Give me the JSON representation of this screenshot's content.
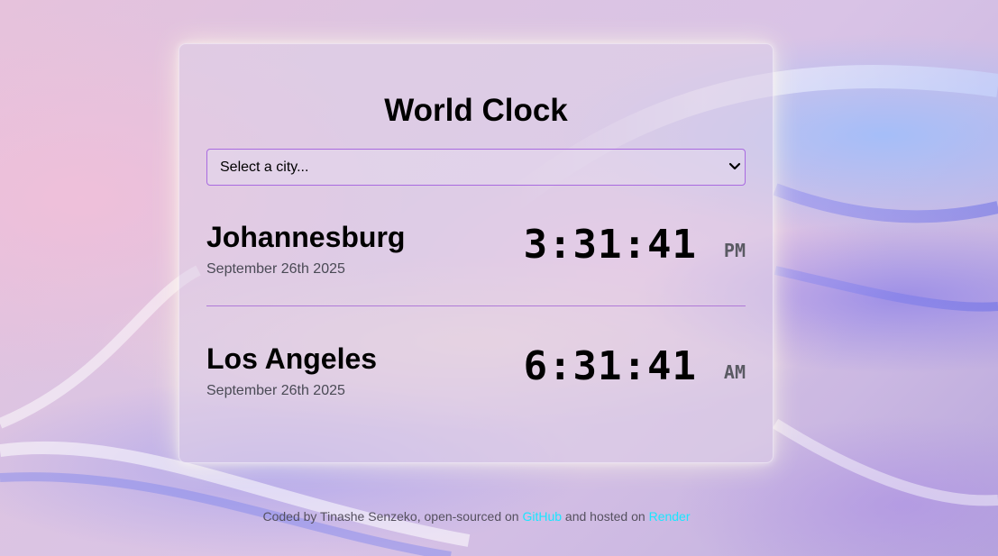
{
  "app": {
    "title": "World Clock"
  },
  "city_select": {
    "selected_label": "Select a city..."
  },
  "cities": [
    {
      "name": "Johannesburg",
      "date": "September 26th 2025",
      "time": "3:31:41",
      "ampm": "PM"
    },
    {
      "name": "Los Angeles",
      "date": "September 26th 2025",
      "time": "6:31:41",
      "ampm": "AM"
    }
  ],
  "footer": {
    "prefix": "Coded by Tinashe Senzeko, open-sourced on ",
    "github_link": "GitHub",
    "middle": " and hosted on ",
    "render_link": "Render"
  },
  "colors": {
    "accent_border": "#a96ae0",
    "link": "#19e6ff"
  },
  "icons": {
    "select_chevron": "chevron-down-icon"
  }
}
